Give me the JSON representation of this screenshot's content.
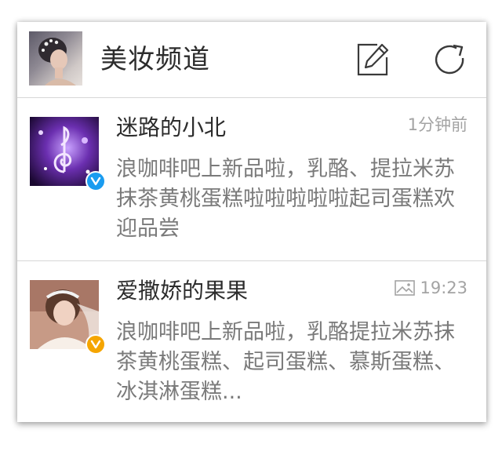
{
  "header": {
    "title": "美妆频道",
    "edit_icon": "edit-icon",
    "refresh_icon": "refresh-icon"
  },
  "items": [
    {
      "name": "迷路的小北",
      "time": "1分钟前",
      "message": "浪咖啡吧上新品啦，乳酪、提拉米苏抹茶黄桃蛋糕啦啦啦啦啦起司蛋糕欢迎品尝",
      "badge_color": "#1a9cf0",
      "has_image_icon": false
    },
    {
      "name": "爱撒娇的果果",
      "time": "19:23",
      "message": "浪咖啡吧上新品啦，乳酪提拉米苏抹茶黄桃蛋糕、起司蛋糕、慕斯蛋糕、冰淇淋蛋糕...",
      "badge_color": "#f5a500",
      "has_image_icon": true
    }
  ],
  "colors": {
    "title": "#2c2c2c",
    "message": "#7a7a7a",
    "time": "#a3a3a3",
    "divider": "#d6d6d6"
  }
}
